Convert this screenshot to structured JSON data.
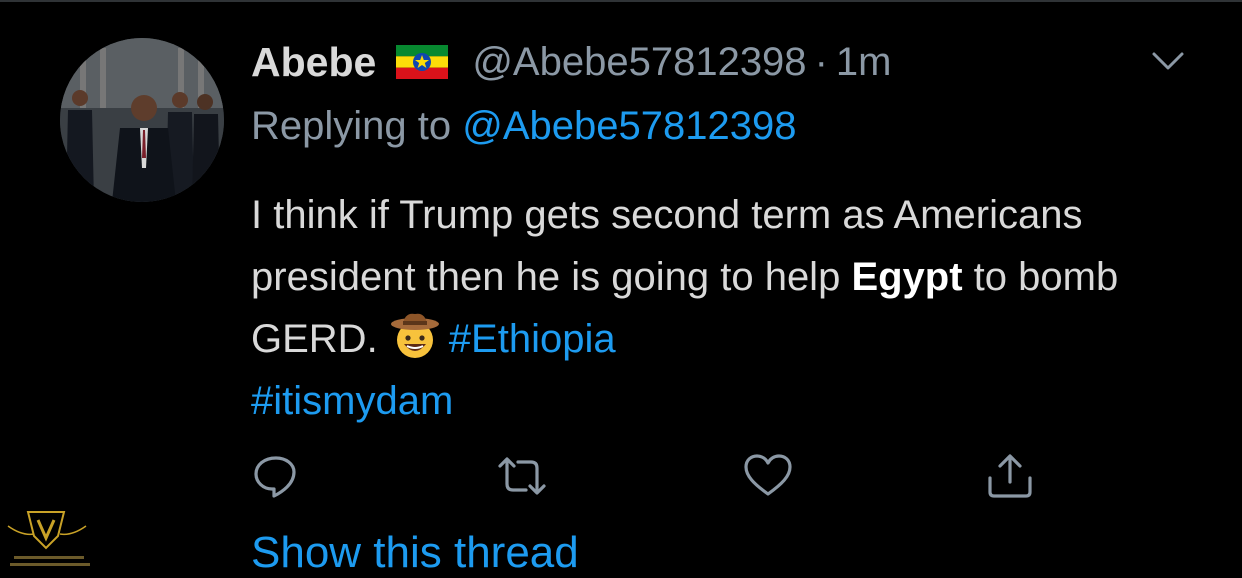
{
  "tweet": {
    "author_name": "Abebe",
    "flag_icon": "ethiopia-flag-emoji",
    "handle": "@Abebe57812398",
    "separator": "·",
    "time": "1m",
    "reply_prefix": "Replying to",
    "reply_mention": "@Abebe57812398",
    "body": {
      "line1_a": "I think if Trump gets second term as Americans president then he is going to help ",
      "bold_word": "Egypt",
      "line1_b": " to bomb GERD. ",
      "emoji": "cowboy-hat-face-emoji",
      "hashtag1": "#Ethiopia",
      "hashtag2": "#itismydam"
    },
    "show_thread": "Show this thread"
  },
  "actions": [
    {
      "name": "reply",
      "icon": "reply-icon"
    },
    {
      "name": "retweet",
      "icon": "retweet-icon"
    },
    {
      "name": "like",
      "icon": "heart-icon"
    },
    {
      "name": "share",
      "icon": "share-icon"
    }
  ],
  "colors": {
    "background": "#000000",
    "text": "#d9d9d9",
    "muted": "#8b98a5",
    "accent": "#1d9bf0"
  }
}
